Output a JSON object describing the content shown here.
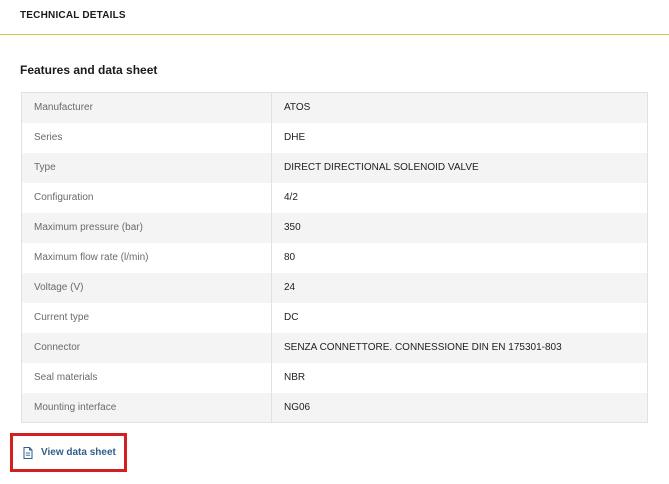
{
  "header": {
    "section_title": "TECHNICAL DETAILS"
  },
  "features": {
    "heading": "Features and data sheet",
    "rows": [
      {
        "label": "Manufacturer",
        "value": "ATOS"
      },
      {
        "label": "Series",
        "value": "DHE"
      },
      {
        "label": "Type",
        "value": "DIRECT DIRECTIONAL SOLENOID VALVE"
      },
      {
        "label": "Configuration",
        "value": "4/2"
      },
      {
        "label": "Maximum pressure (bar)",
        "value": "350"
      },
      {
        "label": "Maximum flow rate (l/min)",
        "value": "80"
      },
      {
        "label": "Voltage (V)",
        "value": "24"
      },
      {
        "label": "Current type",
        "value": "DC"
      },
      {
        "label": "Connector",
        "value": "SENZA CONNETTORE. CONNESSIONE DIN EN 175301-803"
      },
      {
        "label": "Seal materials",
        "value": "NBR"
      },
      {
        "label": "Mounting interface",
        "value": "NG06"
      }
    ]
  },
  "datasheet_link": {
    "label": "View data sheet",
    "icon": "document-icon"
  },
  "colors": {
    "accent_line": "#d9c24a",
    "link": "#2f5f8a",
    "highlight_box": "#d21f1f"
  }
}
